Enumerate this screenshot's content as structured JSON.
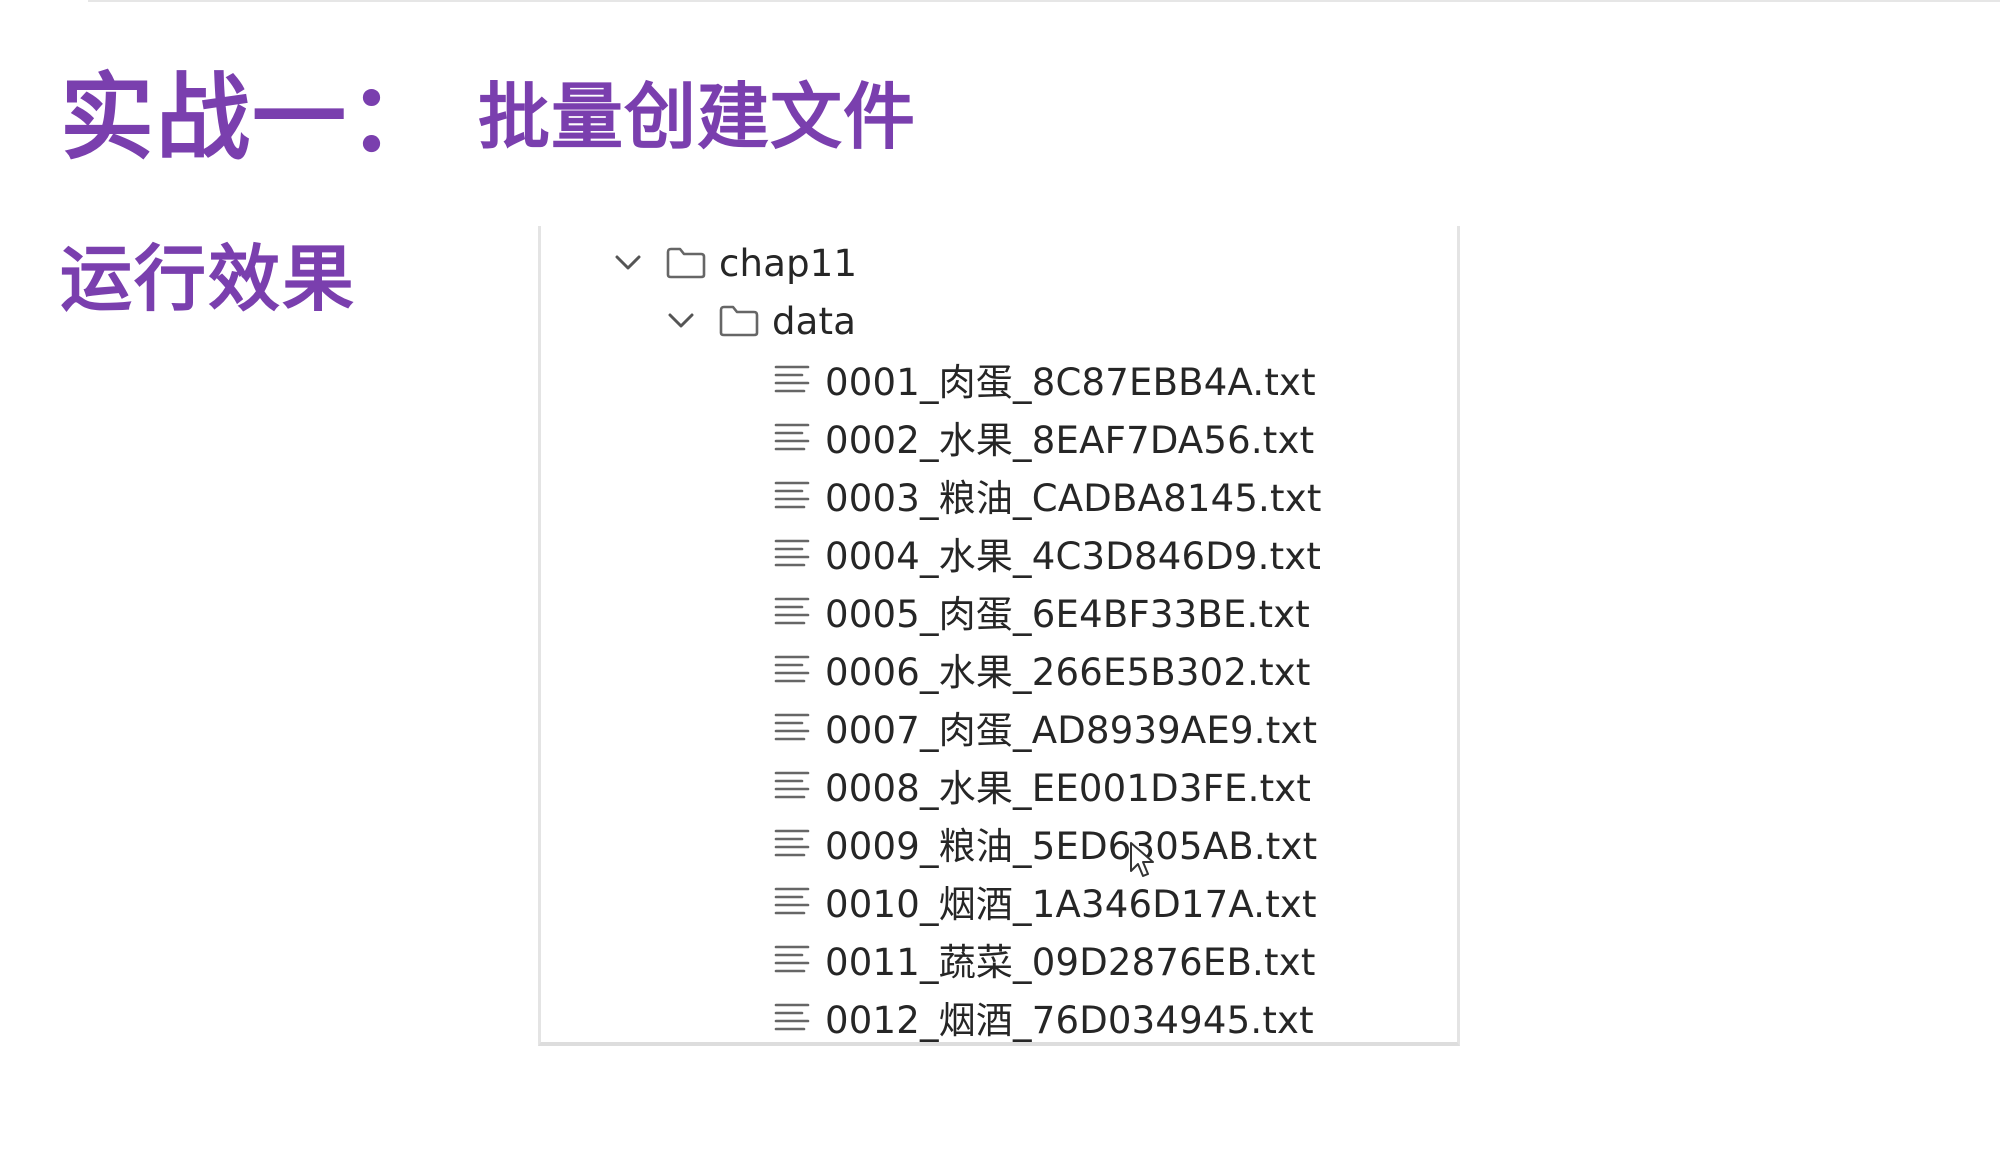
{
  "slide": {
    "title_main": "实战一：",
    "title_sub": "批量创建文件",
    "section_label": "运行效果",
    "accent_color": "#7a3fae"
  },
  "tree": {
    "root": {
      "label": "chap11",
      "icon": "folder-icon",
      "expanded": true
    },
    "folder": {
      "label": "data",
      "icon": "folder-icon",
      "expanded": true
    },
    "files": [
      {
        "label": "0001_肉蛋_8C87EBB4A.txt",
        "icon": "text-file-icon"
      },
      {
        "label": "0002_水果_8EAF7DA56.txt",
        "icon": "text-file-icon"
      },
      {
        "label": "0003_粮油_CADBA8145.txt",
        "icon": "text-file-icon"
      },
      {
        "label": "0004_水果_4C3D846D9.txt",
        "icon": "text-file-icon"
      },
      {
        "label": "0005_肉蛋_6E4BF33BE.txt",
        "icon": "text-file-icon"
      },
      {
        "label": "0006_水果_266E5B302.txt",
        "icon": "text-file-icon"
      },
      {
        "label": "0007_肉蛋_AD8939AE9.txt",
        "icon": "text-file-icon"
      },
      {
        "label": "0008_水果_EE001D3FE.txt",
        "icon": "text-file-icon"
      },
      {
        "label": "0009_粮油_5ED6305AB.txt",
        "icon": "text-file-icon"
      },
      {
        "label": "0010_烟酒_1A346D17A.txt",
        "icon": "text-file-icon"
      },
      {
        "label": "0011_蔬菜_09D2876EB.txt",
        "icon": "text-file-icon"
      },
      {
        "label": "0012_烟酒_76D034945.txt",
        "icon": "text-file-icon"
      }
    ]
  }
}
